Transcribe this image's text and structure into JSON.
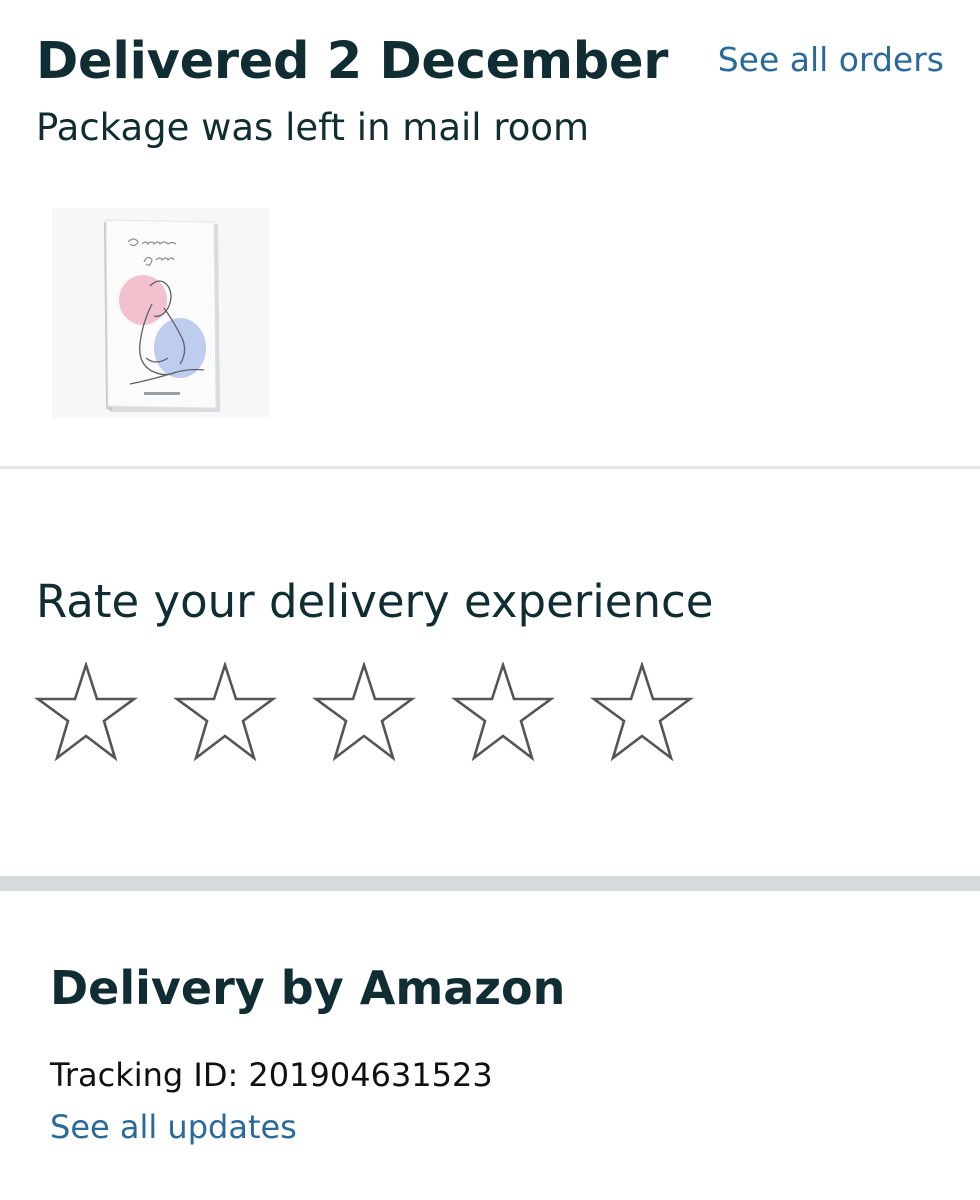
{
  "delivery": {
    "title": "Delivered 2 December",
    "status": "Package was left in mail room",
    "see_all_orders_label": "See all orders",
    "product_image": {
      "alt": "Pregnancy Journal book cover"
    }
  },
  "rating": {
    "title": "Rate your delivery experience",
    "stars_total": 5,
    "stars_selected": 0
  },
  "carrier": {
    "title": "Delivery by Amazon",
    "tracking_label": "Tracking ID:",
    "tracking_id": "201904631523",
    "see_all_updates_label": "See all updates"
  },
  "colors": {
    "heading": "#0f2d33",
    "link": "#2a6a9b",
    "divider_thin": "#e6e8e8",
    "divider_thick": "#d5dbdb",
    "star_outline": "#555555"
  }
}
